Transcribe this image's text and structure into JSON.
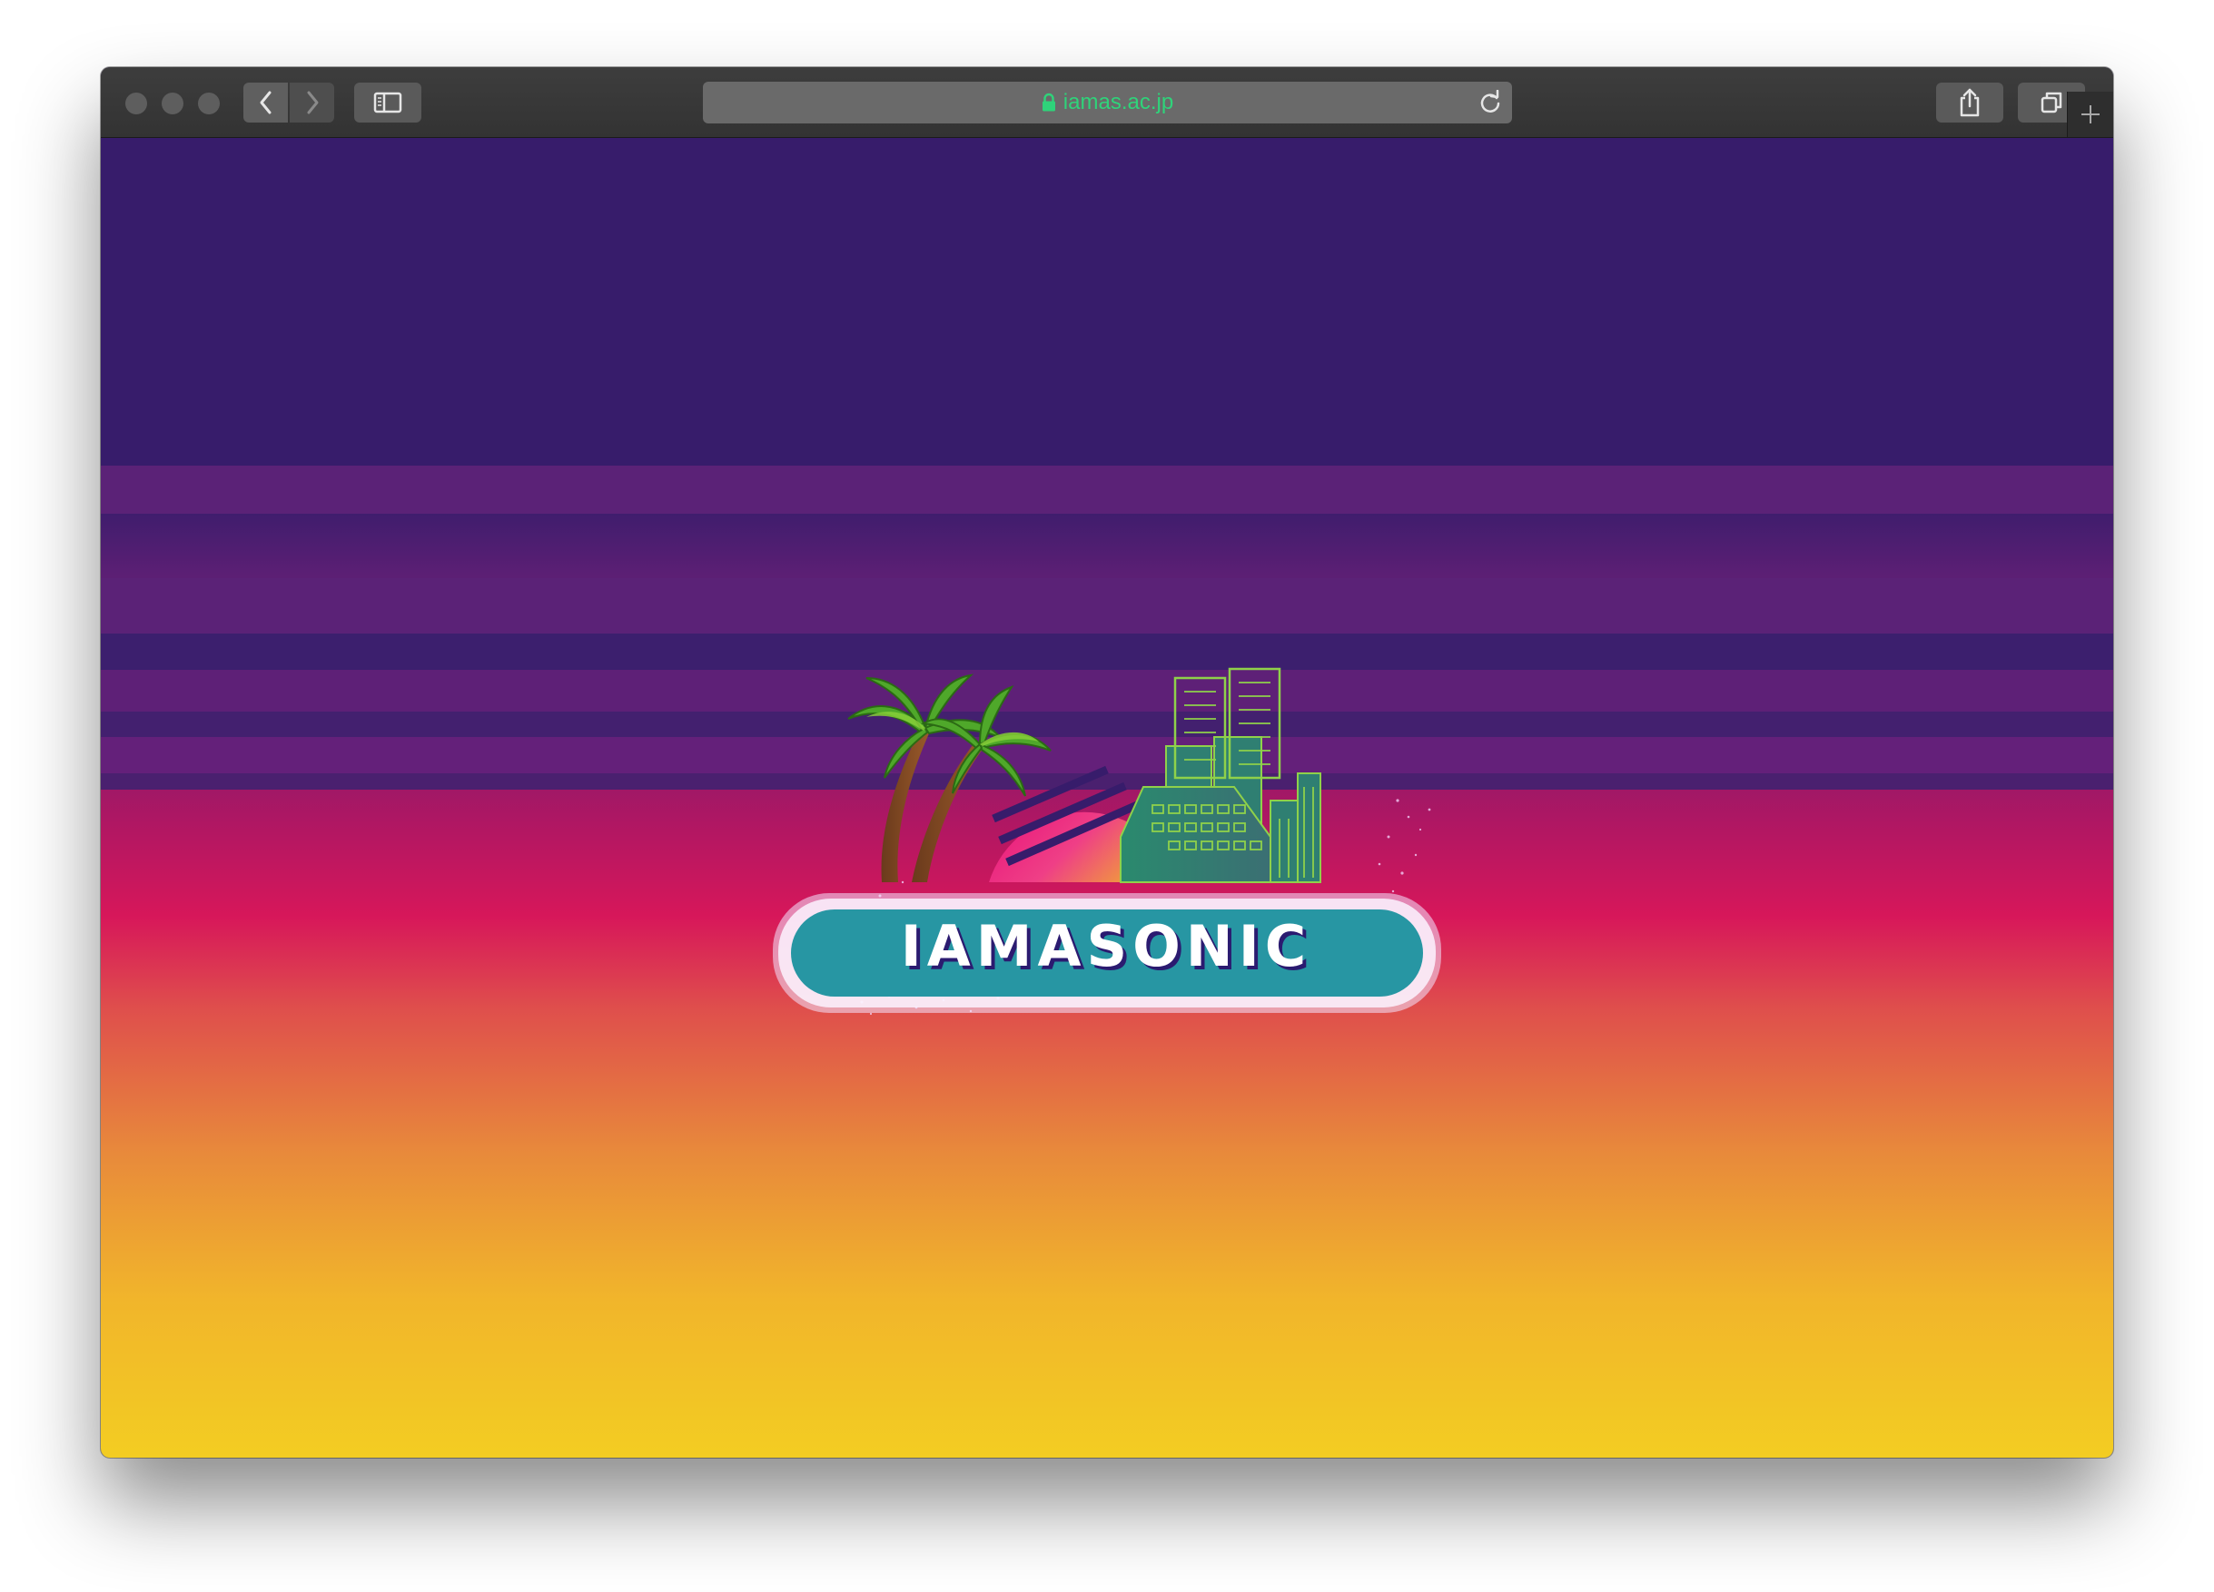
{
  "browser": {
    "url": "iamas.ac.jp",
    "icons": {
      "close": "traffic-light-close",
      "minimize": "traffic-light-minimize",
      "zoom": "traffic-light-zoom",
      "back": "chevron-left-icon",
      "forward": "chevron-right-icon",
      "sidebar": "sidebar-icon",
      "lock": "lock-icon",
      "reload": "reload-icon",
      "share": "share-icon",
      "tabs": "tabs-overview-icon",
      "new_tab": "plus-icon"
    }
  },
  "hero": {
    "logo_text": "IAMASONIC",
    "colors": {
      "sky_top": "#371c6b",
      "band": "#5b2277",
      "magenta": "#d7175a",
      "orange": "#e88a3b",
      "yellow": "#f3cd22",
      "badge": "#2796a3"
    }
  }
}
